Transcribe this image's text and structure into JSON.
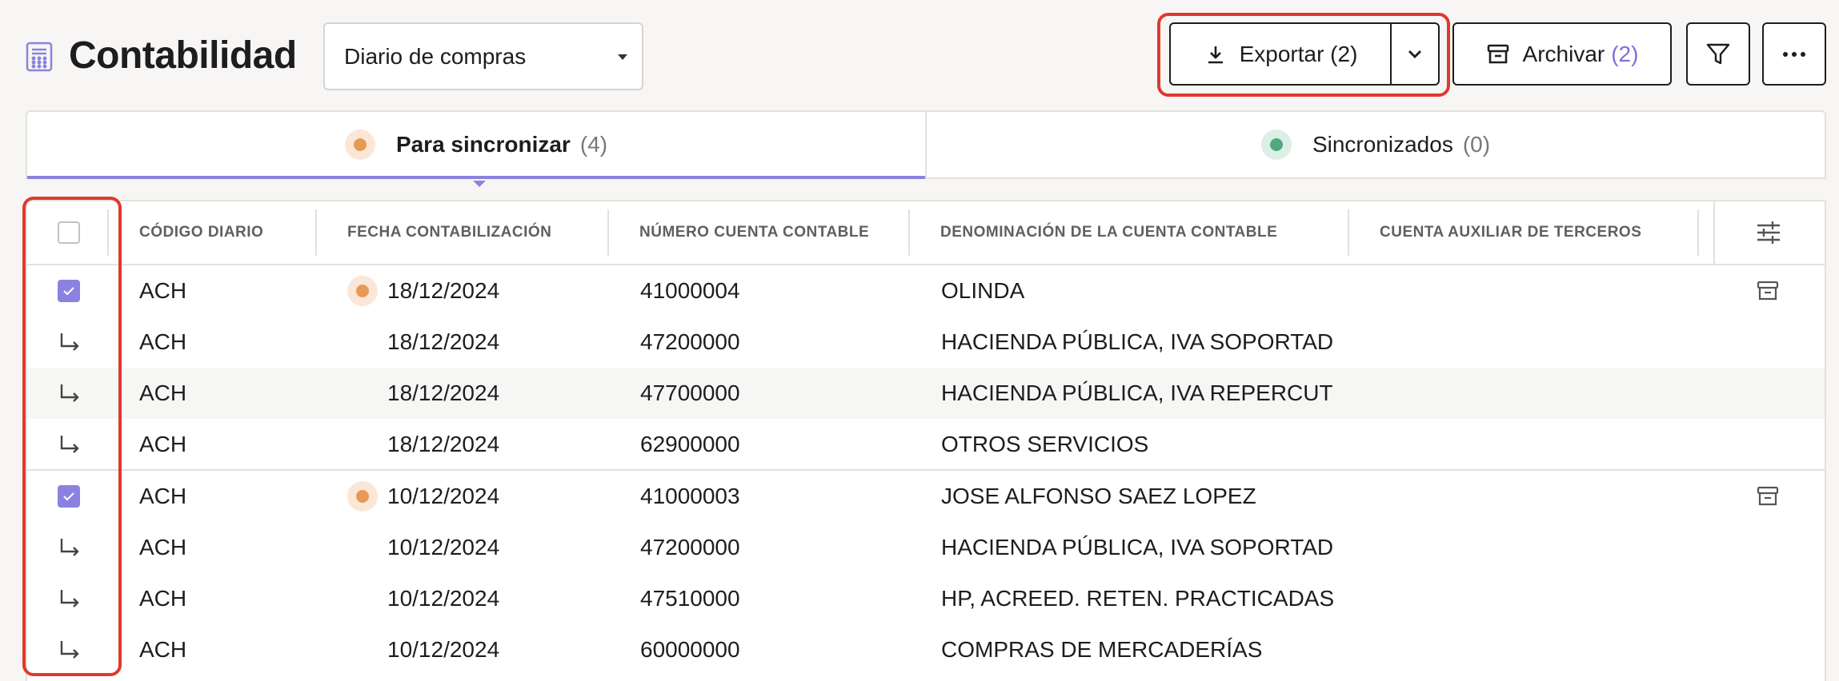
{
  "header": {
    "title": "Contabilidad",
    "journal_select": "Diario de compras",
    "export_label": "Exportar (2)",
    "archive_label": "Archivar",
    "archive_count": "(2)"
  },
  "tabs": [
    {
      "label": "Para sincronizar",
      "count": "(4)",
      "status_color": "#e79a55"
    },
    {
      "label": "Sincronizados",
      "count": "(0)",
      "status_color": "#4faa7d"
    }
  ],
  "table": {
    "columns": [
      "CÓDIGO DIARIO",
      "FECHA CONTABILIZACIÓN",
      "NÚMERO CUENTA CONTABLE",
      "DENOMINACIÓN DE LA CUENTA CONTABLE",
      "CUENTA AUXILIAR DE TERCEROS"
    ],
    "rows": [
      {
        "code": "ACH",
        "date": "18/12/2024",
        "account": "41000004",
        "name": "OLINDA"
      },
      {
        "code": "ACH",
        "date": "18/12/2024",
        "account": "47200000",
        "name": "HACIENDA PÚBLICA, IVA SOPORTAD"
      },
      {
        "code": "ACH",
        "date": "18/12/2024",
        "account": "47700000",
        "name": "HACIENDA PÚBLICA, IVA REPERCUT"
      },
      {
        "code": "ACH",
        "date": "18/12/2024",
        "account": "62900000",
        "name": "OTROS SERVICIOS"
      },
      {
        "code": "ACH",
        "date": "10/12/2024",
        "account": "41000003",
        "name": "JOSE ALFONSO SAEZ LOPEZ"
      },
      {
        "code": "ACH",
        "date": "10/12/2024",
        "account": "47200000",
        "name": "HACIENDA PÚBLICA, IVA SOPORTAD"
      },
      {
        "code": "ACH",
        "date": "10/12/2024",
        "account": "47510000",
        "name": "HP, ACREED. RETEN. PRACTICADAS"
      },
      {
        "code": "ACH",
        "date": "10/12/2024",
        "account": "60000000",
        "name": "COMPRAS DE MERCADERÍAS"
      }
    ]
  },
  "colors": {
    "accent": "#8b82e0",
    "highlight": "#e0392d",
    "pending": "#e79a55",
    "synced": "#4faa7d"
  }
}
